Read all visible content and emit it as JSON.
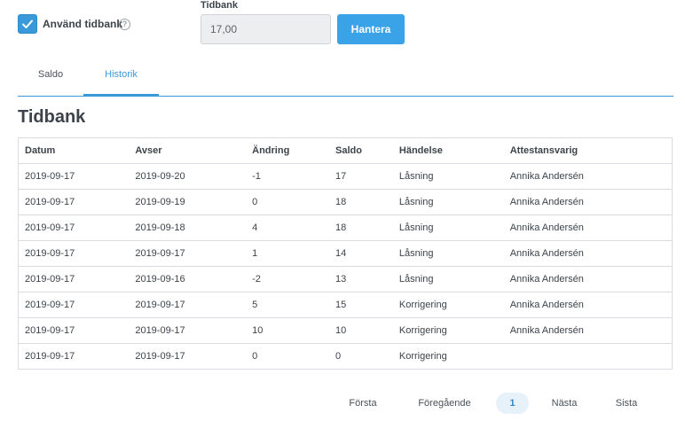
{
  "checkbox": {
    "label": "Använd tidbank",
    "checked": true,
    "help_icon": "?"
  },
  "tidbank": {
    "label": "Tidbank",
    "value": "17,00",
    "button_label": "Hantera"
  },
  "tabs": [
    {
      "label": "Saldo",
      "active": false
    },
    {
      "label": "Historik",
      "active": true
    }
  ],
  "section_title": "Tidbank",
  "table": {
    "headers": [
      "Datum",
      "Avser",
      "Ändring",
      "Saldo",
      "Händelse",
      "Attestansvarig"
    ],
    "rows": [
      [
        "2019-09-17",
        "2019-09-20",
        "-1",
        "17",
        "Låsning",
        "Annika Andersén"
      ],
      [
        "2019-09-17",
        "2019-09-19",
        "0",
        "18",
        "Låsning",
        "Annika Andersén"
      ],
      [
        "2019-09-17",
        "2019-09-18",
        "4",
        "18",
        "Låsning",
        "Annika Andersén"
      ],
      [
        "2019-09-17",
        "2019-09-17",
        "1",
        "14",
        "Låsning",
        "Annika Andersén"
      ],
      [
        "2019-09-17",
        "2019-09-16",
        "-2",
        "13",
        "Låsning",
        "Annika Andersén"
      ],
      [
        "2019-09-17",
        "2019-09-17",
        "5",
        "15",
        "Korrigering",
        "Annika Andersén"
      ],
      [
        "2019-09-17",
        "2019-09-17",
        "10",
        "10",
        "Korrigering",
        "Annika Andersén"
      ],
      [
        "2019-09-17",
        "2019-09-17",
        "0",
        "0",
        "Korrigering",
        ""
      ]
    ]
  },
  "pagination": {
    "first": "Första",
    "prev": "Föregående",
    "current": "1",
    "next": "Nästa",
    "last": "Sista"
  },
  "colors": {
    "accent": "#3a9ad9",
    "button": "#3aa3e8"
  }
}
